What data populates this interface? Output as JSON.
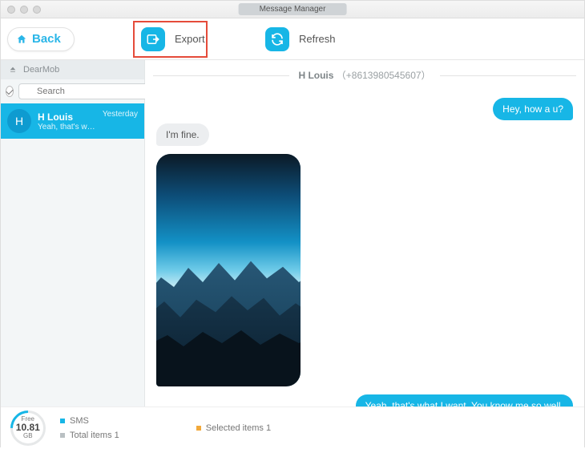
{
  "window": {
    "title": "Message Manager"
  },
  "toolbar": {
    "back": "Back",
    "export": "Export",
    "refresh": "Refresh"
  },
  "sidebar": {
    "device": "DearMob",
    "search_placeholder": "Search",
    "conversations": [
      {
        "initial": "H",
        "name": "H Louis",
        "preview": "Yeah, that's what I want. You kno...",
        "time": "Yesterday"
      }
    ]
  },
  "chat": {
    "header_name": "H Louis",
    "header_phone": "（+8613980545607）",
    "messages": {
      "m1": "Hey, how a u?",
      "m2": "I'm fine.",
      "m3": "Yeah, that's what I want. You know me so well."
    }
  },
  "footer": {
    "free_label": "Free",
    "free_size": "10.81",
    "free_unit": "GB",
    "sms_label": "SMS",
    "total_label": "Total items 1",
    "selected_label": "Selected items 1"
  }
}
